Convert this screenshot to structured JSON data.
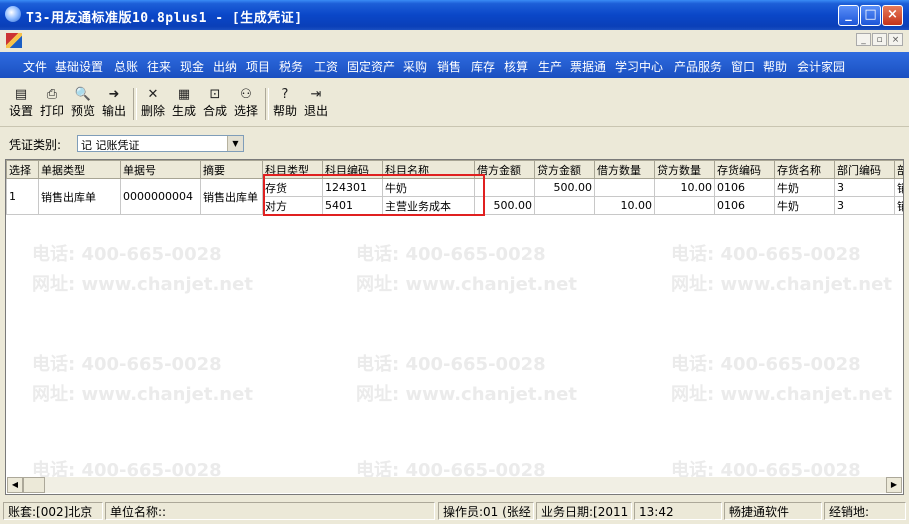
{
  "window": {
    "title": "T3-用友通标准版10.8plus1 - [生成凭证]"
  },
  "menu": [
    "文件",
    "基础设置",
    "总账",
    "往来",
    "现金",
    "出纳",
    "项目",
    "税务",
    "工资",
    "固定资产",
    "采购",
    "销售",
    "库存",
    "核算",
    "生产",
    "票据通",
    "学习中心",
    "产品服务",
    "窗口",
    "帮助",
    "会计家园"
  ],
  "toolbar": [
    {
      "label": "设置",
      "icon": "settings-icon"
    },
    {
      "label": "打印",
      "icon": "print-icon"
    },
    {
      "label": "预览",
      "icon": "preview-icon"
    },
    {
      "label": "输出",
      "icon": "export-icon"
    },
    {
      "label": "删除",
      "icon": "delete-icon"
    },
    {
      "label": "生成",
      "icon": "generate-icon"
    },
    {
      "label": "合成",
      "icon": "merge-icon"
    },
    {
      "label": "选择",
      "icon": "binoculars-icon"
    },
    {
      "label": "帮助",
      "icon": "help-icon"
    },
    {
      "label": "退出",
      "icon": "exit-icon"
    }
  ],
  "voucher": {
    "label": "凭证类别:",
    "value": "记 记账凭证"
  },
  "columns": [
    "选择",
    "单据类型",
    "单据号",
    "摘要",
    "科目类型",
    "科目编码",
    "科目名称",
    "借方金额",
    "贷方金额",
    "借方数量",
    "贷方数量",
    "存货编码",
    "存货名称",
    "部门编码",
    "部"
  ],
  "record": {
    "select": "1",
    "doc_type": "销售出库单",
    "doc_no": "0000000004",
    "summary": "销售出库单"
  },
  "lines": [
    [
      "存货",
      "124301",
      "牛奶",
      "",
      "500.00",
      "",
      "10.00",
      "0106",
      "牛奶",
      "3",
      "销"
    ],
    [
      "对方",
      "5401",
      "主营业务成本",
      "500.00",
      "",
      "10.00",
      "",
      "0106",
      "牛奶",
      "3",
      "销"
    ]
  ],
  "watermark": {
    "phone": "电话: 400-665-0028",
    "site": "网址: www.chanjet.net"
  },
  "status": {
    "account_set": "账套:[002]北京",
    "unit": "单位名称::",
    "operator": "操作员:01 (张经",
    "business_date": "业务日期:[2011",
    "time": "13:42",
    "vendor": "畅捷通软件",
    "dealer": "经销地:"
  },
  "colors": {
    "title_bar": "#0a47c8",
    "menu_bar": "#1a4fc0",
    "highlight": "#e02020"
  }
}
